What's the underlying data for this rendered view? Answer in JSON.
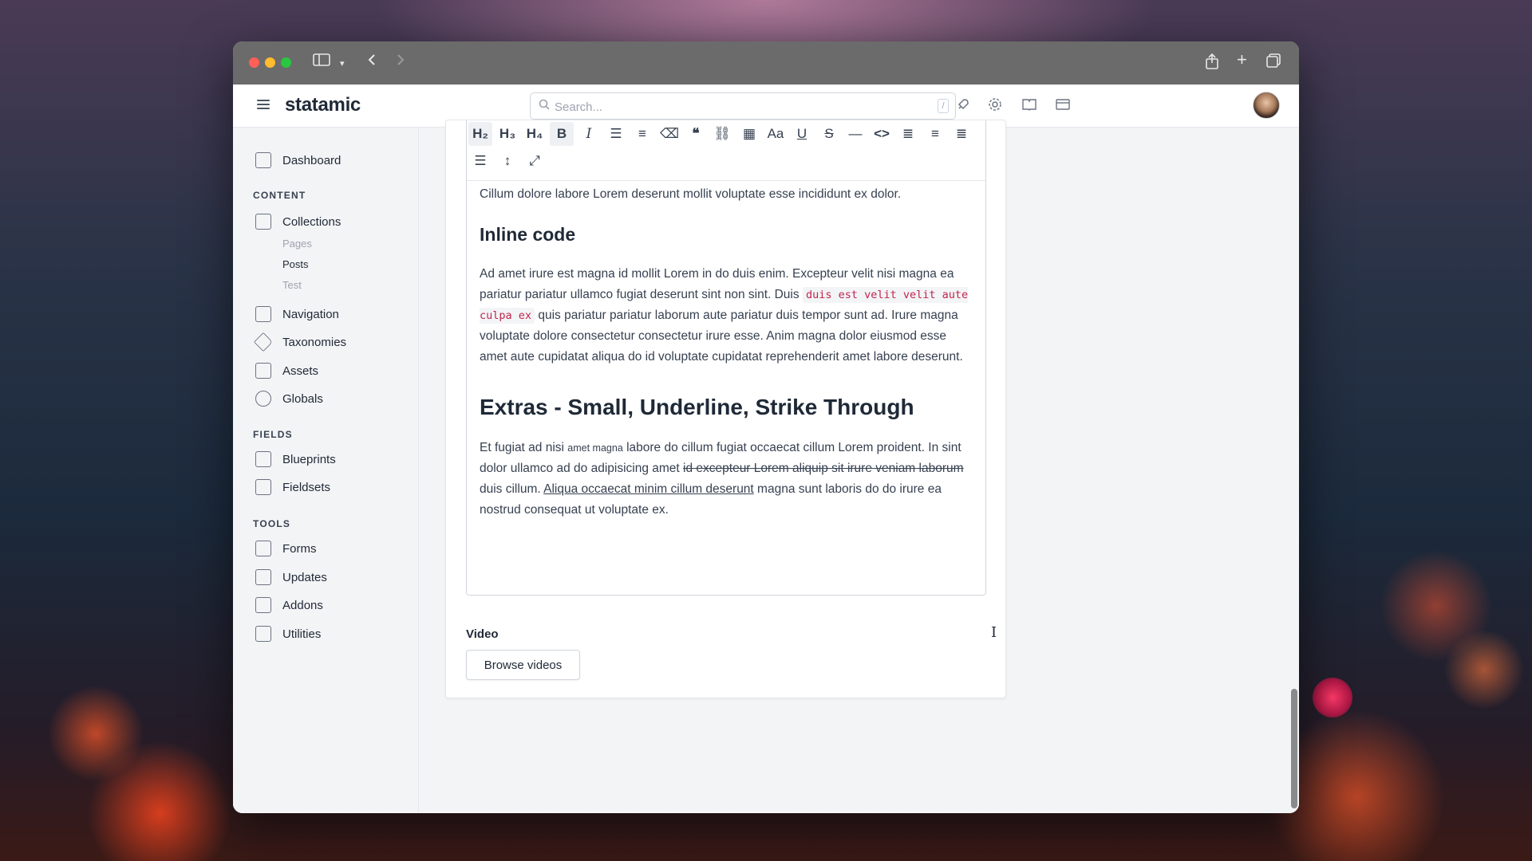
{
  "browser": {
    "sidebar_toggle_icon": "sidebar-icon",
    "back_icon": "chevron-left-icon",
    "forward_icon": "chevron-right-icon",
    "share_icon": "share-icon",
    "new_tab_icon": "plus-icon",
    "tabs_icon": "tabs-overview-icon"
  },
  "header": {
    "logo": "statamic",
    "search_placeholder": "Search...",
    "search_shortcut": "/"
  },
  "sidebar": {
    "dashboard": "Dashboard",
    "content_label": "CONTENT",
    "collections": "Collections",
    "collection_items": [
      "Pages",
      "Posts",
      "Test"
    ],
    "navigation": "Navigation",
    "taxonomies": "Taxonomies",
    "assets": "Assets",
    "globals": "Globals",
    "fields_label": "FIELDS",
    "blueprints": "Blueprints",
    "fieldsets": "Fieldsets",
    "tools_label": "TOOLS",
    "forms": "Forms",
    "updates": "Updates",
    "addons": "Addons",
    "utilities": "Utilities"
  },
  "toolbar": {
    "h2": "H₂",
    "h3": "H₃",
    "h4": "H₄",
    "bold": "B",
    "italic": "I",
    "buttons": [
      "h2",
      "h3",
      "h4",
      "bold",
      "italic",
      "bullet-list",
      "ordered-list",
      "eraser",
      "quote",
      "link",
      "table",
      "font-size",
      "underline",
      "strikethrough",
      "horizontal-rule",
      "code",
      "align-left",
      "align-center",
      "align-right",
      "align-justify",
      "line-height",
      "fullscreen"
    ]
  },
  "content": {
    "intro": "Cillum dolore labore Lorem deserunt mollit voluptate esse incididunt ex dolor.",
    "h_inline_code": "Inline code",
    "p1_a": "Ad amet irure est magna id mollit Lorem in do duis enim. Excepteur velit nisi magna ea pariatur pariatur ullamco fugiat deserunt sint non sint. Duis ",
    "p1_code": "duis est velit velit aute culpa ex",
    "p1_b": " quis pariatur pariatur laborum aute pariatur duis tempor sunt ad. Irure magna voluptate dolore consectetur consectetur irure esse. Anim magna dolor eiusmod esse amet aute cupidatat aliqua do id voluptate cupidatat reprehenderit amet labore deserunt.",
    "h_extras": "Extras - Small, Underline, Strike Through",
    "p2_a": "Et fugiat ad nisi ",
    "p2_small": "amet magna",
    "p2_b": " labore do cillum fugiat occaecat cillum Lorem proident. In sint dolor ullamco ad do adipisicing amet ",
    "p2_strike": "id excepteur Lorem aliquip sit irure veniam laborum",
    "p2_c": " duis cillum. ",
    "p2_under": "Aliqua occaecat minim cillum deserunt",
    "p2_d": " magna sunt laboris do do irure ea nostrud consequat ut voluptate ex."
  },
  "video": {
    "label": "Video",
    "button": "Browse videos"
  }
}
